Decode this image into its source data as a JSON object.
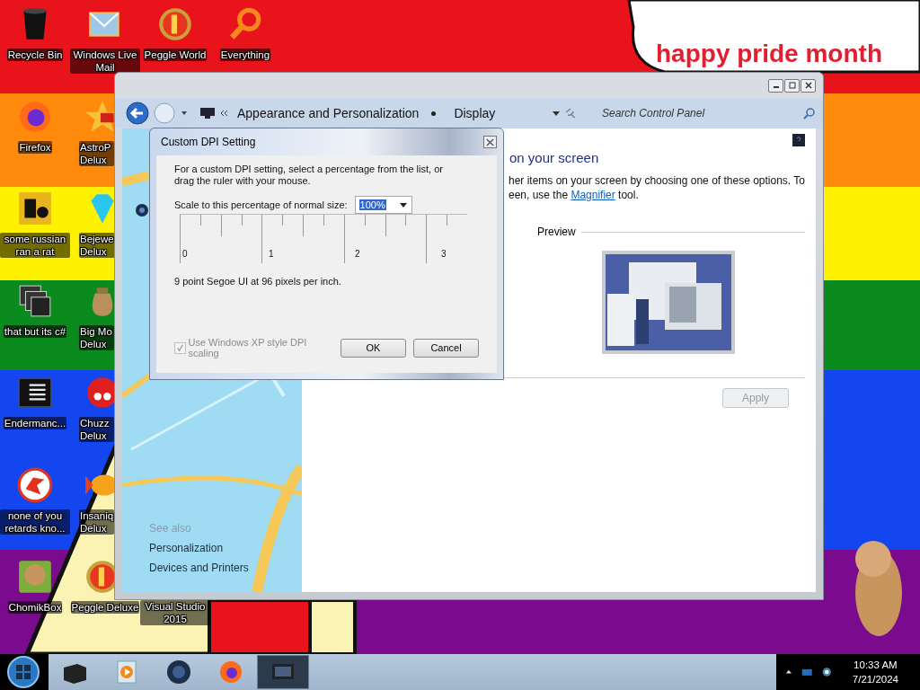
{
  "wallpaper": {
    "caption": "happy pride month"
  },
  "desktop_icons": [
    [
      {
        "label": "Recycle Bin",
        "kind": "bin"
      },
      {
        "label": "Firefox",
        "kind": "firefox"
      },
      {
        "label": "some russian ran a rat",
        "kind": "tile"
      },
      {
        "label": "that but its c#",
        "kind": "stack"
      },
      {
        "label": "Endermanc...",
        "kind": "terminal"
      },
      {
        "label": "none of you retards kno...",
        "kind": "lizard"
      },
      {
        "label": "ChomikBox",
        "kind": "hamster"
      }
    ],
    [
      {
        "label": "Windows Live Mail",
        "kind": "mail"
      },
      {
        "label": "AstroP Delux",
        "kind": "star"
      },
      {
        "label": "Bejewe Delux",
        "kind": "gem"
      },
      {
        "label": "Big Mo Delux",
        "kind": "bag"
      },
      {
        "label": "Chuzz Delux",
        "kind": "blob"
      },
      {
        "label": "Insaniq Delux",
        "kind": "fish"
      },
      {
        "label": "Peggle Deluxe",
        "kind": "peggle"
      }
    ],
    [
      {
        "label": "Peggle World",
        "kind": "peggle"
      },
      {
        "label": "Visual Studio 2015",
        "kind": "studio"
      }
    ],
    [
      {
        "label": "Everything",
        "kind": "magnifier"
      }
    ]
  ],
  "control_panel": {
    "breadcrumbs": [
      "Appearance and Personalization",
      "Display"
    ],
    "search": {
      "placeholder": "Search Control Panel"
    },
    "sidebar": {
      "heading": "See also",
      "items": [
        "Personalization",
        "Devices and Printers"
      ]
    },
    "heading": "on your screen",
    "description": {
      "line_1": "her items on your screen by choosing one of these options. To",
      "line_2": "een, use the ",
      "link": "Magnifier",
      "line_2_end": " tool."
    },
    "preview_label": "Preview",
    "apply": {
      "label": "Apply",
      "disabled": true
    }
  },
  "dpi_dialog": {
    "title": "Custom DPI Setting",
    "instructions": "For a custom DPI setting, select a percentage from the list, or drag the ruler with your mouse.",
    "scale_label": "Scale to this percentage of normal size:",
    "scale_value": "100%",
    "ruler_labels": [
      "0",
      "1",
      "2",
      "3"
    ],
    "font_info": "9 point Segoe UI at 96 pixels per inch.",
    "xp_scaling": {
      "label": "Use Windows XP style DPI scaling",
      "checked": true,
      "disabled": true
    },
    "buttons": [
      "OK",
      "Cancel"
    ]
  },
  "taskbar": {
    "apps": [
      {
        "kind": "box",
        "selected": false
      },
      {
        "kind": "media",
        "selected": false
      },
      {
        "kind": "globe",
        "selected": false
      },
      {
        "kind": "firefox",
        "selected": false
      },
      {
        "kind": "window",
        "selected": true
      }
    ],
    "time": "10:33 AM",
    "date": "7/21/2024"
  }
}
